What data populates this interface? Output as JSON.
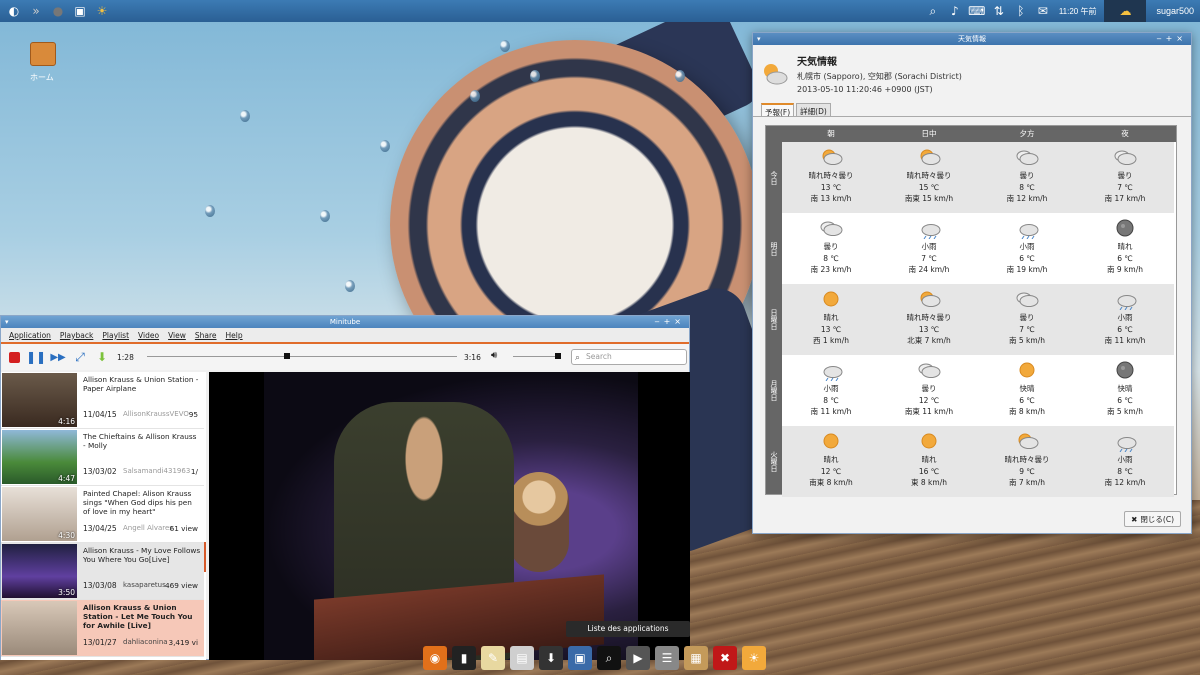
{
  "top_panel": {
    "clock": "11:20 午前",
    "user": "sugar500"
  },
  "desktop": {
    "home_label": "ホーム"
  },
  "weather": {
    "window_title": "天気情報",
    "heading": "天気情報",
    "location": "札幌市 (Sapporo), 空知郡 (Sorachi District)",
    "timestamp": "2013-05-10 11:20:46 +0900 (JST)",
    "tabs": [
      "予報(F)",
      "詳細(D)"
    ],
    "columns": [
      "朝",
      "日中",
      "夕方",
      "夜"
    ],
    "rows": [
      {
        "day": "今日",
        "cells": [
          {
            "icon": "partly-cloudy-icon",
            "cond": "晴れ時々曇り",
            "temp": "13 ℃",
            "wind": "南 13 km/h"
          },
          {
            "icon": "partly-cloudy-icon",
            "cond": "晴れ時々曇り",
            "temp": "15 ℃",
            "wind": "南東 15 km/h"
          },
          {
            "icon": "cloudy-icon",
            "cond": "曇り",
            "temp": "8 ℃",
            "wind": "南 12 km/h"
          },
          {
            "icon": "cloudy-icon",
            "cond": "曇り",
            "temp": "7 ℃",
            "wind": "南 17 km/h"
          }
        ]
      },
      {
        "day": "明日",
        "cells": [
          {
            "icon": "cloudy-icon",
            "cond": "曇り",
            "temp": "8 ℃",
            "wind": "南 23 km/h"
          },
          {
            "icon": "rain-icon",
            "cond": "小雨",
            "temp": "7 ℃",
            "wind": "南 24 km/h"
          },
          {
            "icon": "rain-icon",
            "cond": "小雨",
            "temp": "6 ℃",
            "wind": "南 19 km/h"
          },
          {
            "icon": "moon-icon",
            "cond": "晴れ",
            "temp": "6 ℃",
            "wind": "南 9 km/h"
          }
        ]
      },
      {
        "day": "日曜日",
        "cells": [
          {
            "icon": "sun-icon",
            "cond": "晴れ",
            "temp": "13 ℃",
            "wind": "西 1 km/h"
          },
          {
            "icon": "partly-cloudy-icon",
            "cond": "晴れ時々曇り",
            "temp": "13 ℃",
            "wind": "北東 7 km/h"
          },
          {
            "icon": "cloudy-icon",
            "cond": "曇り",
            "temp": "7 ℃",
            "wind": "南 5 km/h"
          },
          {
            "icon": "rain-icon",
            "cond": "小雨",
            "temp": "6 ℃",
            "wind": "南 11 km/h"
          }
        ]
      },
      {
        "day": "月曜日",
        "cells": [
          {
            "icon": "rain-icon",
            "cond": "小雨",
            "temp": "8 ℃",
            "wind": "南 11 km/h"
          },
          {
            "icon": "cloudy-icon",
            "cond": "曇り",
            "temp": "12 ℃",
            "wind": "南東 11 km/h"
          },
          {
            "icon": "sun-icon",
            "cond": "快晴",
            "temp": "6 ℃",
            "wind": "南 8 km/h"
          },
          {
            "icon": "moon-icon",
            "cond": "快晴",
            "temp": "6 ℃",
            "wind": "南 5 km/h"
          }
        ]
      },
      {
        "day": "火曜日",
        "cells": [
          {
            "icon": "sun-icon",
            "cond": "晴れ",
            "temp": "12 ℃",
            "wind": "南東 8 km/h"
          },
          {
            "icon": "sun-icon",
            "cond": "晴れ",
            "temp": "16 ℃",
            "wind": "東 8 km/h"
          },
          {
            "icon": "partly-cloudy-icon",
            "cond": "晴れ時々曇り",
            "temp": "9 ℃",
            "wind": "南 7 km/h"
          },
          {
            "icon": "rain-icon",
            "cond": "小雨",
            "temp": "8 ℃",
            "wind": "南 12 km/h"
          }
        ]
      }
    ],
    "close_label": "閉じる(C)"
  },
  "player": {
    "window_title": "Minitube",
    "menu": [
      "Application",
      "Playback",
      "Playlist",
      "Video",
      "View",
      "Share",
      "Help"
    ],
    "time_elapsed": "1:28",
    "time_total": "3:16",
    "progress": 0.45,
    "search_placeholder": "Search",
    "playlist": [
      {
        "title": "Allison Krauss & Union Station - Paper Airplane",
        "date": "11/04/15",
        "channel": "AllisonKraussVEVO",
        "views": "95",
        "duration": "4:16",
        "state": "normal"
      },
      {
        "title": "The Chieftains & Allison Krauss - Molly",
        "date": "13/03/02",
        "channel": "Salsamandi431963",
        "views": "1/",
        "duration": "4:47",
        "state": "normal"
      },
      {
        "title": "Painted Chapel: Alison Krauss sings \"When God dips his pen of love in my heart\"",
        "date": "13/04/25",
        "channel": "Angell Alvares",
        "views": "61 view",
        "duration": "4:30",
        "state": "normal"
      },
      {
        "title": "Allison Krauss - My Love Follows You Where You Go[Live]",
        "date": "13/03/08",
        "channel": "kasaparetus",
        "views": "469 view",
        "duration": "3:50",
        "state": "selected"
      },
      {
        "title": "Allison Krauss & Union Station - Let Me Touch You for Awhile [Live]",
        "date": "13/01/27",
        "channel": "dahliaconina",
        "views": "3,419 vi",
        "duration": "",
        "state": "playing"
      }
    ]
  },
  "dock": {
    "tooltip": "Liste des applications",
    "items": [
      "firefox-icon",
      "terminal-icon",
      "text-editor-icon",
      "file-cabinet-icon",
      "download-icon",
      "screenshot-icon",
      "search-icon",
      "media-icon",
      "mixer-icon",
      "package-icon",
      "close-icon",
      "weather-icon"
    ]
  }
}
